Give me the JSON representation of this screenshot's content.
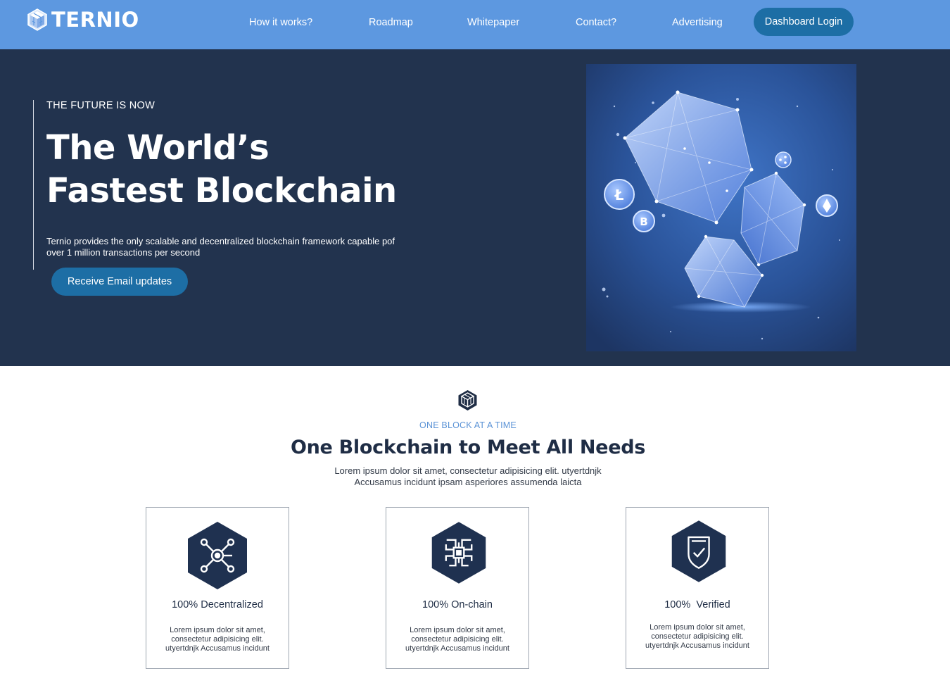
{
  "brand": {
    "name": "TERNIO",
    "logo_icon": "cube-logo-icon"
  },
  "nav": {
    "links": [
      {
        "label": "How it works?"
      },
      {
        "label": "Roadmap"
      },
      {
        "label": "Whitepaper"
      },
      {
        "label": "Contact?"
      },
      {
        "label": "Advertising"
      }
    ],
    "login_label": "Dashboard Login"
  },
  "hero": {
    "eyebrow": "THE FUTURE IS NOW",
    "headline_line1": "The World’s",
    "headline_line2": "Fastest Blockchain",
    "description_line1": "Ternio provides the only scalable and decentralized  blockchain framework capable pof",
    "description_line2": "over 1 million transactions per second",
    "cta_label": "Receive Email updates",
    "illustration": "crystal-blockchain-illustration"
  },
  "section": {
    "icon": "cube-icon",
    "eyebrow": "ONE BLOCK AT A TIME",
    "title": "One Blockchain to Meet All Needs",
    "description_line1": "Lorem ipsum dolor sit amet, consectetur adipisicing elit. utyertdnjk",
    "description_line2": "Accusamus incidunt ipsam asperiores assumenda laicta"
  },
  "features": [
    {
      "icon": "network-nodes-icon",
      "title": "100% Decentralized",
      "desc_line1": "Lorem ipsum dolor sit amet,",
      "desc_line2": "consectetur adipisicing elit.",
      "desc_line3": "utyertdnjk Accusamus incidunt"
    },
    {
      "icon": "chip-icon",
      "title": "100% On-chain",
      "desc_line1": "Lorem ipsum dolor sit amet,",
      "desc_line2": "consectetur adipisicing elit.",
      "desc_line3": "utyertdnjk Accusamus incidunt"
    },
    {
      "icon": "shield-check-icon",
      "title": "100%  Verified",
      "desc_line1": "Lorem ipsum dolor sit amet,",
      "desc_line2": "consectetur adipisicing elit.",
      "desc_line3": "utyertdnjk Accusamus incidunt"
    }
  ],
  "colors": {
    "nav_bg": "#5d98e0",
    "hero_bg": "#22334e",
    "button_bg": "#1d6ea5",
    "heading_dark": "#1f2d45",
    "accent_text": "#5b93d6"
  }
}
